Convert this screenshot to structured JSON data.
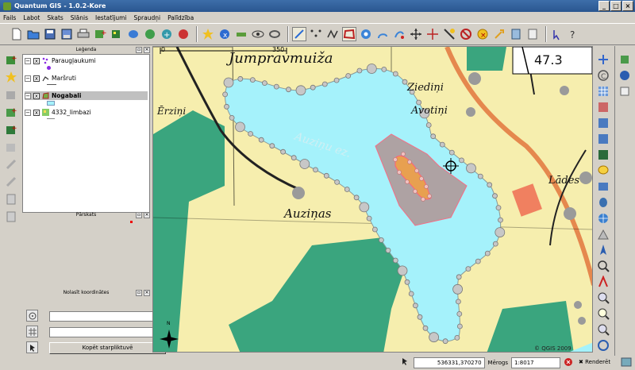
{
  "window": {
    "title": "Quantum GIS - 1.0.2-Kore",
    "minimize": "_",
    "maximize": "□",
    "close": "×"
  },
  "menu": [
    "Fails",
    "Labot",
    "Skats",
    "Slānis",
    "Iestatījumi",
    "Spraudņi",
    "Palīdzība"
  ],
  "toolbar": {
    "icons": [
      "new-project-icon",
      "open-project-icon",
      "save-project-icon",
      "save-as-icon",
      "print-icon",
      "add-vector-icon",
      "add-raster-icon",
      "add-postgis-icon",
      "add-wms-icon",
      "new-layer-icon",
      "remove-layer-icon",
      "toggle-edit-icon",
      "identify-icon",
      "measure-icon",
      "capture-point-icon",
      "capture-line-icon",
      "capture-polygon-icon",
      "move-feature-icon",
      "split-icon",
      "add-ring-icon",
      "add-island-icon",
      "vertex-move-icon",
      "vertex-add-icon",
      "vertex-delete-icon",
      "delete-feature-icon",
      "cut-icon",
      "copy-icon",
      "paste-icon",
      "plugin-icon",
      "help-icon"
    ]
  },
  "legend": {
    "title": "Leģenda",
    "layers": [
      {
        "name": "Paraugļaukumi",
        "checked": "x",
        "expand": "−"
      },
      {
        "name": "Maršruti",
        "checked": "x",
        "expand": "−"
      },
      {
        "name": "Nogabali",
        "checked": "x",
        "expand": "−"
      },
      {
        "name": "4332_limbazi",
        "checked": "x",
        "expand": "−"
      }
    ]
  },
  "overview": {
    "title": "Pārskats"
  },
  "coordinates": {
    "title": "Nolasīt koordinātes",
    "copy_button": "Kopēt starpliktuvē",
    "x_value": "",
    "y_value": ""
  },
  "map": {
    "scale_zero": "0",
    "scale_max": "350",
    "labels": {
      "top": "Jumpravmuiža",
      "ziedini": "Ziediņi",
      "avotini": "Avotiņi",
      "auzinas": "Auziņas",
      "lades": "Lādes",
      "lake": "Auziņu ez.",
      "road": "47.3",
      "erzini": "Ērziņi"
    },
    "copyright": "© QGIS 2009",
    "north": "N"
  },
  "status": {
    "coords": "536331,370270",
    "scale_label": "Mērogs",
    "scale_value": "1:8017",
    "render_label": "Renderēt"
  },
  "colors": {
    "water": "#a5f2fb",
    "land": "#f6eeae",
    "forest": "#3aa57e",
    "selected": "#ff5f7a",
    "vertex": "#c7c7c7"
  }
}
